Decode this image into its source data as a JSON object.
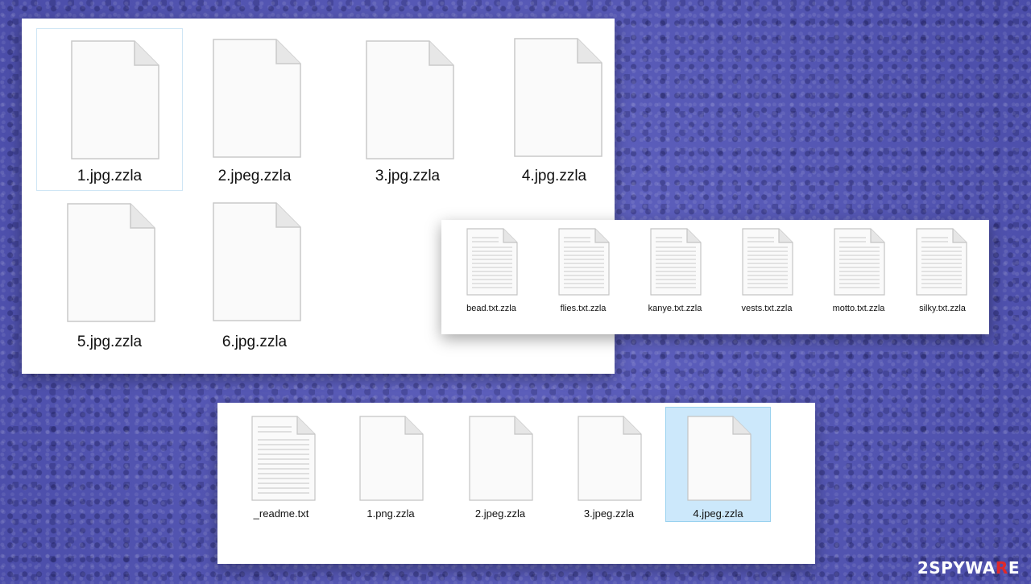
{
  "window1": {
    "files": [
      {
        "name": "1.jpg.zzla",
        "icon": "blank-file-icon",
        "state": "hover"
      },
      {
        "name": "2.jpeg.zzla",
        "icon": "blank-file-icon"
      },
      {
        "name": "3.jpg.zzla",
        "icon": "blank-file-icon"
      },
      {
        "name": "4.jpg.zzla",
        "icon": "blank-file-icon"
      },
      {
        "name": "5.jpg.zzla",
        "icon": "blank-file-icon"
      },
      {
        "name": "6.jpg.zzla",
        "icon": "blank-file-icon"
      }
    ]
  },
  "window2": {
    "files": [
      {
        "name": "bead.txt.zzla",
        "icon": "text-file-icon"
      },
      {
        "name": "flies.txt.zzla",
        "icon": "text-file-icon"
      },
      {
        "name": "kanye.txt.zzla",
        "icon": "text-file-icon"
      },
      {
        "name": "vests.txt.zzla",
        "icon": "text-file-icon"
      },
      {
        "name": "motto.txt.zzla",
        "icon": "text-file-icon"
      },
      {
        "name": "silky.txt.zzla",
        "icon": "text-file-icon"
      }
    ]
  },
  "window3": {
    "files": [
      {
        "name": "_readme.txt",
        "icon": "text-file-icon"
      },
      {
        "name": "1.png.zzla",
        "icon": "blank-file-icon"
      },
      {
        "name": "2.jpeg.zzla",
        "icon": "blank-file-icon"
      },
      {
        "name": "3.jpeg.zzla",
        "icon": "blank-file-icon"
      },
      {
        "name": "4.jpeg.zzla",
        "icon": "blank-file-icon",
        "state": "selected"
      }
    ]
  },
  "watermark": {
    "part1": "2SPYWA",
    "part2": "R",
    "part3": "E"
  },
  "colors": {
    "background": "#5355b3",
    "selection": "#cce8fb",
    "selection_border": "#99d1ef",
    "watermark_accent": "#e0292a"
  }
}
